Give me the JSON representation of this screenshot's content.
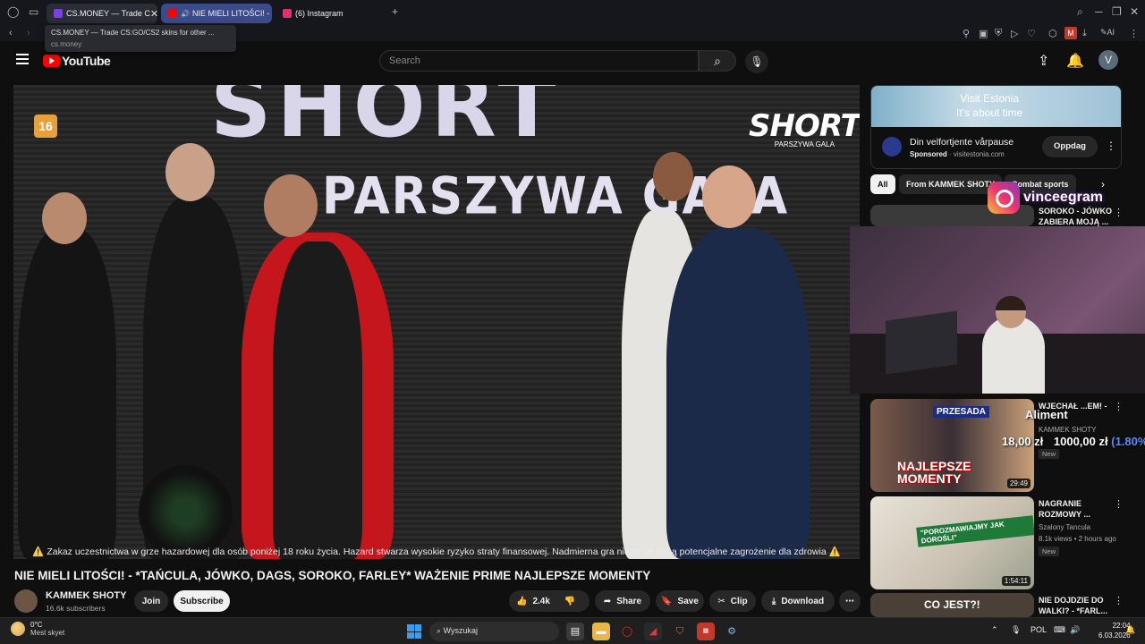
{
  "browser": {
    "tabs": [
      {
        "label": "CS.MONEY — Trade C",
        "icon_color": "#7b3fe4",
        "active": true
      },
      {
        "label": "NIE MIELI LITOŚCI! -",
        "icon_color": "#ff0000",
        "active": false
      },
      {
        "label": "(6) Instagram",
        "icon_color": "#e1306c",
        "active": false
      }
    ],
    "new_tab": "+",
    "tooltip": {
      "title": "CS.MONEY — Trade CS:GO/CS2 skins for other ...",
      "url": "cs.money"
    }
  },
  "youtube": {
    "logo": "YouTube",
    "search_placeholder": "Search",
    "avatar_letter": "V"
  },
  "video": {
    "age_rating": "16",
    "backdrop_line1": "SHORT",
    "backdrop_line2": "PARSZYWA GALA",
    "brand_logo": "SHORT",
    "brand_sub": "PARSZYWA GALA",
    "disclaimer": "⚠️ Zakaz uczestnictwa w grze hazardowej dla osób poniżej 18 roku życia. Hazard stwarza wysokie ryzyko straty finansowej. Nadmierna gra niesie ze sobą potencjalne zagrożenie dla zdrowia ⚠️",
    "title": "NIE MIELI LITOŚCI! - *TAŃCULA, JÓWKO, DAGS, SOROKO, FARLEY* WAŻENIE PRIME NAJLEPSZE MOMENTY",
    "channel": "KAMMEK SHOTY",
    "subscribers": "16.6k subscribers",
    "join": "Join",
    "subscribe": "Subscribe",
    "likes": "2.4k",
    "share": "Share",
    "save": "Save",
    "clip": "Clip",
    "download": "Download"
  },
  "ad": {
    "banner_line1": "Visit Estonia",
    "banner_line2": "It's about time",
    "title": "Din velfortjente vårpause",
    "sponsored": "Sponsored",
    "domain": "visitestonia.com",
    "cta": "Oppdag"
  },
  "chips": [
    "All",
    "From KAMMEK SHOTY",
    "Combat sports"
  ],
  "recommendations": [
    {
      "title": "SOROKO - JÓWKO ZABIERA MOJĄ ...",
      "channel": "",
      "meta": "",
      "duration": "",
      "new": ""
    },
    {
      "title": "WJECHAŁ ...EM! - ...",
      "channel": "KAMMEK SHOTY",
      "meta": "",
      "duration": "29:49",
      "new": "New",
      "thumb_text1": "PRZESADA",
      "thumb_text2": "NAJLEPSZE MOMENTY"
    },
    {
      "title": "NAGRANIE ROZMOWY ...",
      "channel": "Szalony Tancula",
      "meta": "8.1k views • 2 hours ago",
      "duration": "1:54:11",
      "new": "New",
      "thumb_text1": "\"POROZMAWIAJMY JAK DOROŚLI\""
    },
    {
      "title": "NIE DOJDZIE DO WALKI? - *FARL...",
      "channel": "",
      "meta": "",
      "duration": "",
      "new": "",
      "thumb_text1": "CO JEST?!"
    }
  ],
  "overlay": {
    "instagram_handle": "vinceegram",
    "donate_label": "Aliment",
    "donate_amount1": "18,00 zł",
    "donate_amount2": "1000,00 zł",
    "donate_pct": "(1.80%)"
  },
  "taskbar": {
    "temp": "0°C",
    "weather": "Mest skyet",
    "search": "Wyszukaj",
    "lang": "POL",
    "time": "22:04",
    "date": "6.03.2026"
  }
}
